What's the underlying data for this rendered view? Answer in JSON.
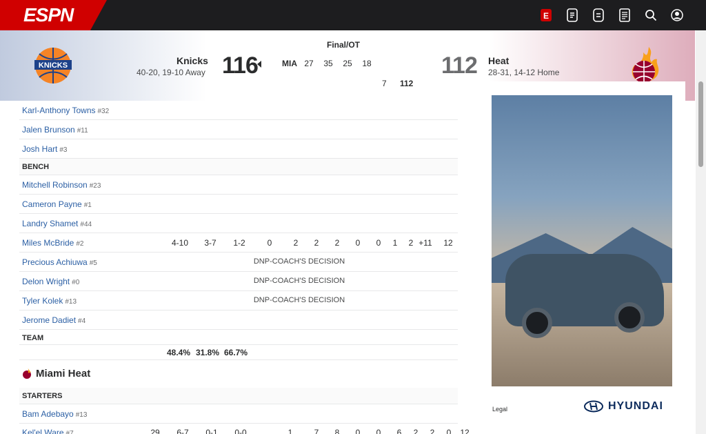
{
  "nav": {
    "brand": "ESPN",
    "icons": [
      "espn-plus-icon",
      "watch-icon",
      "listen-icon",
      "scores-icon",
      "search-icon",
      "profile-icon"
    ]
  },
  "game": {
    "status": "Final/OT",
    "away": {
      "name": "Knicks",
      "record": "40-20, 19-10 Away",
      "score": "116"
    },
    "home": {
      "name": "Heat",
      "record": "28-31, 14-12 Home",
      "score": "112"
    },
    "linescore": {
      "row1": [
        "",
        "",
        "",
        "",
        ""
      ],
      "row2": [
        "",
        "",
        "",
        "",
        ""
      ],
      "row3": [
        "",
        "",
        "",
        "",
        ""
      ],
      "labels": [
        "MIA",
        "27",
        "35",
        "25",
        "18",
        "7",
        "112"
      ]
    }
  },
  "boxscore": {
    "away_starters_visible": [
      {
        "name": "Karl-Anthony Towns",
        "num": "#32"
      },
      {
        "name": "Jalen Brunson",
        "num": "#11"
      },
      {
        "name": "Josh Hart",
        "num": "#3"
      }
    ],
    "bench_label": "BENCH",
    "bench": [
      {
        "name": "Mitchell Robinson",
        "num": "#23"
      },
      {
        "name": "Cameron Payne",
        "num": "#1"
      },
      {
        "name": "Landry Shamet",
        "num": "#44"
      },
      {
        "name": "Miles McBride",
        "num": "#2",
        "stats": [
          "4-10",
          "3-7",
          "1-2",
          "0",
          "2",
          "2",
          "2",
          "0",
          "0",
          "1",
          "2",
          "+11",
          "12"
        ]
      },
      {
        "name": "Precious Achiuwa",
        "num": "#5",
        "dnp": "DNP-COACH'S DECISION"
      },
      {
        "name": "Delon Wright",
        "num": "#0",
        "dnp": "DNP-COACH'S DECISION"
      },
      {
        "name": "Tyler Kolek",
        "num": "#13",
        "dnp": "DNP-COACH'S DECISION"
      },
      {
        "name": "Jerome Dadiet",
        "num": "#4"
      }
    ],
    "team_label": "TEAM",
    "percentages": [
      "48.4%",
      "31.8%",
      "66.7%"
    ],
    "home_team_title": "Miami Heat",
    "starters_label": "STARTERS",
    "home_starters": [
      {
        "name": "Bam Adebayo",
        "num": "#13"
      },
      {
        "name": "Kel'el Ware",
        "num": "#7",
        "stats": [
          "29",
          "6-7",
          "0-1",
          "0-0",
          "1",
          "7",
          "8",
          "0",
          "0",
          "6",
          "2",
          "2",
          "0",
          "12"
        ]
      }
    ]
  },
  "ad": {
    "legal": "Legal",
    "brand": "HYUNDAI"
  },
  "colors": {
    "nav_bg": "#1d1d1f",
    "brand_red": "#d00000",
    "link_blue": "#2b5fa4",
    "knicks_blue": "#1d428a",
    "knicks_orange": "#f58426",
    "heat_red": "#98002e"
  }
}
